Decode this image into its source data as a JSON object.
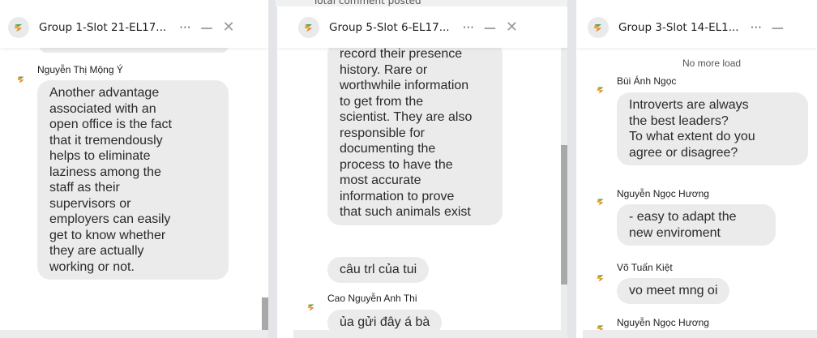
{
  "top_partial_text": "Total comment posted",
  "panels": [
    {
      "title": "Group 1-Slot 21-EL17...",
      "more_label": "···",
      "minimize_label": "—",
      "close_label": "✕",
      "messages": [
        {
          "author": "Nguyễn Thị Mộng Ý",
          "lines": [
            "Another advantage",
            "associated with an",
            "open office is the fact",
            "that it tremendously",
            "helps to eliminate",
            "laziness among the",
            "staff as their",
            "supervisors or",
            "employers can easily",
            "get to know whether",
            "they are actually",
            "working or not."
          ]
        }
      ]
    },
    {
      "title": "Group 5-Slot 6-EL17...",
      "more_label": "···",
      "minimize_label": "—",
      "close_label": "✕",
      "messages": [
        {
          "lines": [
            "record their presence",
            "history. Rare or",
            "worthwhile information",
            "to get from the",
            "scientist. They are also",
            "responsible for",
            "documenting the",
            "process to have the",
            "most accurate",
            "information to prove",
            "that such animals exist"
          ]
        },
        {
          "lines": [
            "câu trl của tui"
          ]
        },
        {
          "author": "Cao Nguyễn Anh Thi",
          "lines": [
            "ủa gửi đây á bà"
          ]
        }
      ]
    },
    {
      "title": "Group 3-Slot 14-EL1...",
      "more_label": "···",
      "minimize_label": "—",
      "no_more_label": "No more load",
      "messages": [
        {
          "author": "Bùi Ánh Ngọc",
          "lines": [
            "Introverts are always",
            "the best leaders?",
            "To what extent do you",
            "agree or disagree?"
          ]
        },
        {
          "author": "Nguyễn Ngọc Hương",
          "lines": [
            "- easy to adapt the",
            "new enviroment"
          ]
        },
        {
          "author": "Võ Tuấn Kiệt",
          "lines": [
            "vo meet mng oi"
          ]
        },
        {
          "author": "Nguyễn Ngọc Hương"
        }
      ]
    }
  ]
}
